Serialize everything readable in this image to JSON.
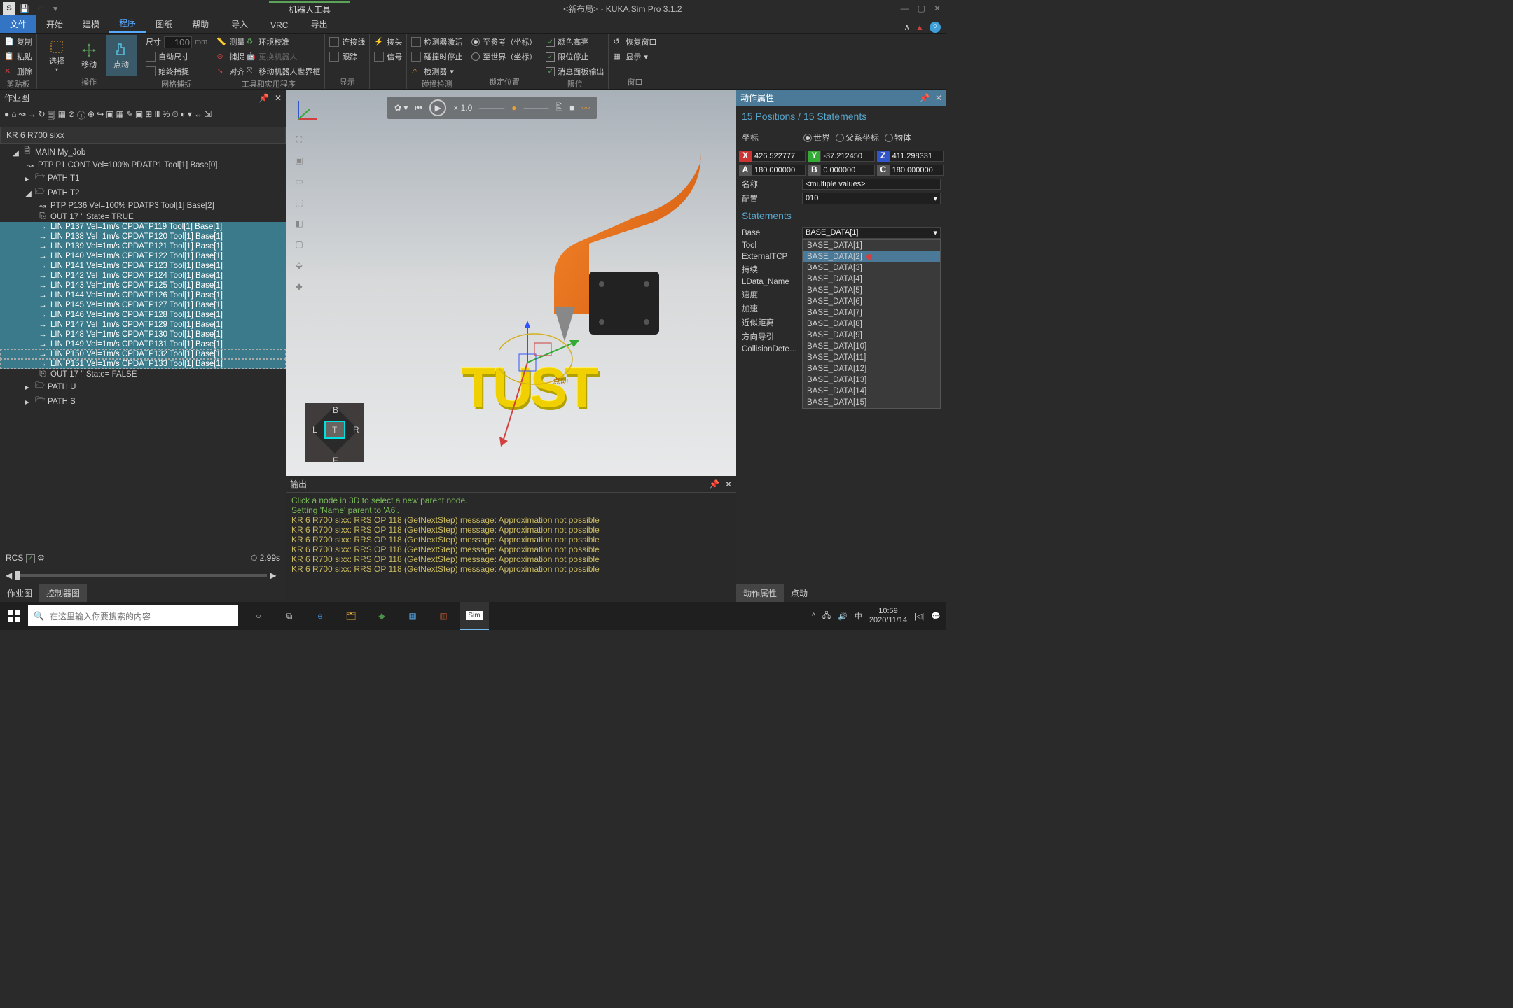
{
  "titlebar": {
    "qat_s": "S",
    "contextual_tab": "机器人工具",
    "title": "<新布局> - KUKA.Sim Pro 3.1.2"
  },
  "menu": {
    "file": "文件",
    "home": "开始",
    "model": "建模",
    "program": "程序",
    "drawing": "图纸",
    "help": "帮助",
    "import": "导入",
    "vrc": "VRC",
    "export": "导出"
  },
  "ribbon": {
    "clipboard": {
      "label": "剪贴板",
      "copy": "复制",
      "paste": "粘贴",
      "delete": "删除"
    },
    "ops": {
      "label": "操作",
      "select": "选择",
      "move": "移动",
      "jog": "点动"
    },
    "grid": {
      "label": "网格捕捉",
      "dim": "尺寸",
      "dimval": "100",
      "dimunit": "mm",
      "auto": "自动尺寸",
      "always": "始终捕捉"
    },
    "tools": {
      "label": "工具和实用程序",
      "measure": "测量",
      "snap": "捕捉",
      "align": "对齐",
      "envcal": "环境校准",
      "swaprobot": "更换机器人",
      "moverobotworld": "移动机器人世界框"
    },
    "show": {
      "label": "显示",
      "conn": "连接线",
      "trace": "跟踪",
      "connect": "接头",
      "signal": "信号"
    },
    "collision": {
      "label": "碰撞检测",
      "on_enter": "检测器激活",
      "on_collision": "碰撞时停止",
      "detector": "检测器"
    },
    "lockpos": {
      "label": "锁定位置",
      "ref_world": "至参考（坐标）",
      "world": "至世界（坐标）"
    },
    "limits": {
      "label": "限位",
      "color": "颜色高亮",
      "limit": "限位停止",
      "panel": "消息面板输出"
    },
    "window": {
      "label": "窗口",
      "restore": "恢复窗口",
      "show": "显示"
    }
  },
  "leftpanel": {
    "title": "作业图",
    "robot": "KR 6 R700 sixx",
    "main": "MAIN My_Job",
    "ptp1": "PTP P1 CONT Vel=100% PDATP1 Tool[1] Base[0]",
    "path_t1": "PATH T1",
    "path_t2": "PATH T2",
    "ptp136": "PTP P136  Vel=100% PDATP3 Tool[1] Base[2]",
    "out17_t": "OUT 17 ''  State= TRUE",
    "out17_f": "OUT 17 ''  State= FALSE",
    "path_u": "PATH U",
    "path_s": "PATH S",
    "lins": [
      "LIN P137  Vel=1m/s CPDATP119 Tool[1] Base[1]",
      "LIN P138  Vel=1m/s CPDATP120 Tool[1] Base[1]",
      "LIN P139  Vel=1m/s CPDATP121 Tool[1] Base[1]",
      "LIN P140  Vel=1m/s CPDATP122 Tool[1] Base[1]",
      "LIN P141  Vel=1m/s CPDATP123 Tool[1] Base[1]",
      "LIN P142  Vel=1m/s CPDATP124 Tool[1] Base[1]",
      "LIN P143  Vel=1m/s CPDATP125 Tool[1] Base[1]",
      "LIN P144  Vel=1m/s CPDATP126 Tool[1] Base[1]",
      "LIN P145  Vel=1m/s CPDATP127 Tool[1] Base[1]",
      "LIN P146  Vel=1m/s CPDATP128 Tool[1] Base[1]",
      "LIN P147  Vel=1m/s CPDATP129 Tool[1] Base[1]",
      "LIN P148  Vel=1m/s CPDATP130 Tool[1] Base[1]",
      "LIN P149  Vel=1m/s CPDATP131 Tool[1] Base[1]",
      "LIN P150  Vel=1m/s CPDATP132 Tool[1] Base[1]",
      "LIN P151  Vel=1m/s CPDATP133 Tool[1] Base[1]"
    ],
    "rcs": "RCS",
    "time": "2.99s",
    "tab_job": "作业图",
    "tab_ctrl": "控制器图"
  },
  "sim": {
    "speed": "× 1.0"
  },
  "navcube": {
    "B": "B",
    "F": "F",
    "L": "L",
    "R": "R",
    "T": "T"
  },
  "viewport": {
    "jog_label": "点动",
    "text3d": "TUST"
  },
  "output": {
    "title": "输出",
    "lines": [
      "Click a node in 3D to select a new parent node.",
      "Setting 'Name' parent to 'A6'.",
      "KR 6 R700 sixx: RRS OP 118 (GetNextStep) message: Approximation not possible",
      "KR 6 R700 sixx: RRS OP 118 (GetNextStep) message: Approximation not possible",
      "KR 6 R700 sixx: RRS OP 118 (GetNextStep) message: Approximation not possible",
      "KR 6 R700 sixx: RRS OP 118 (GetNextStep) message: Approximation not possible",
      "KR 6 R700 sixx: RRS OP 118 (GetNextStep) message: Approximation not possible",
      "KR 6 R700 sixx: RRS OP 118 (GetNextStep) message: Approximation not possible"
    ]
  },
  "right": {
    "title": "动作属性",
    "positions": "15 Positions / 15 Statements",
    "coord_label": "坐标",
    "radios": {
      "world": "世界",
      "parent": "父系坐标",
      "object": "物体"
    },
    "X": "426.522777",
    "Y": "-37.212450",
    "Z": "411.298331",
    "A": "180.000000",
    "B": "0.000000",
    "C": "180.000000",
    "name_lbl": "名称",
    "name_val": "<multiple values>",
    "config_lbl": "配置",
    "config_val": "010",
    "statements": "Statements",
    "base_lbl": "Base",
    "base_val": "BASE_DATA[1]",
    "tool_lbl": "Tool",
    "ext_lbl": "ExternalTCP",
    "cont_lbl": "持续",
    "ldata_lbl": "LData_Name",
    "speed_lbl": "速度",
    "accel_lbl": "加速",
    "approx_lbl": "近似距离",
    "orient_lbl": "方向导引",
    "coll_lbl": "CollisionDetec...",
    "base_options": [
      "BASE_DATA[1]",
      "BASE_DATA[2]",
      "BASE_DATA[3]",
      "BASE_DATA[4]",
      "BASE_DATA[5]",
      "BASE_DATA[6]",
      "BASE_DATA[7]",
      "BASE_DATA[8]",
      "BASE_DATA[9]",
      "BASE_DATA[10]",
      "BASE_DATA[11]",
      "BASE_DATA[12]",
      "BASE_DATA[13]",
      "BASE_DATA[14]",
      "BASE_DATA[15]"
    ],
    "tab_prop": "动作属性",
    "tab_jog": "点动"
  },
  "taskbar": {
    "search_placeholder": "在这里输入你要搜索的内容",
    "ime": "中",
    "time": "10:59",
    "date": "2020/11/14",
    "sim_label": "Sim"
  }
}
